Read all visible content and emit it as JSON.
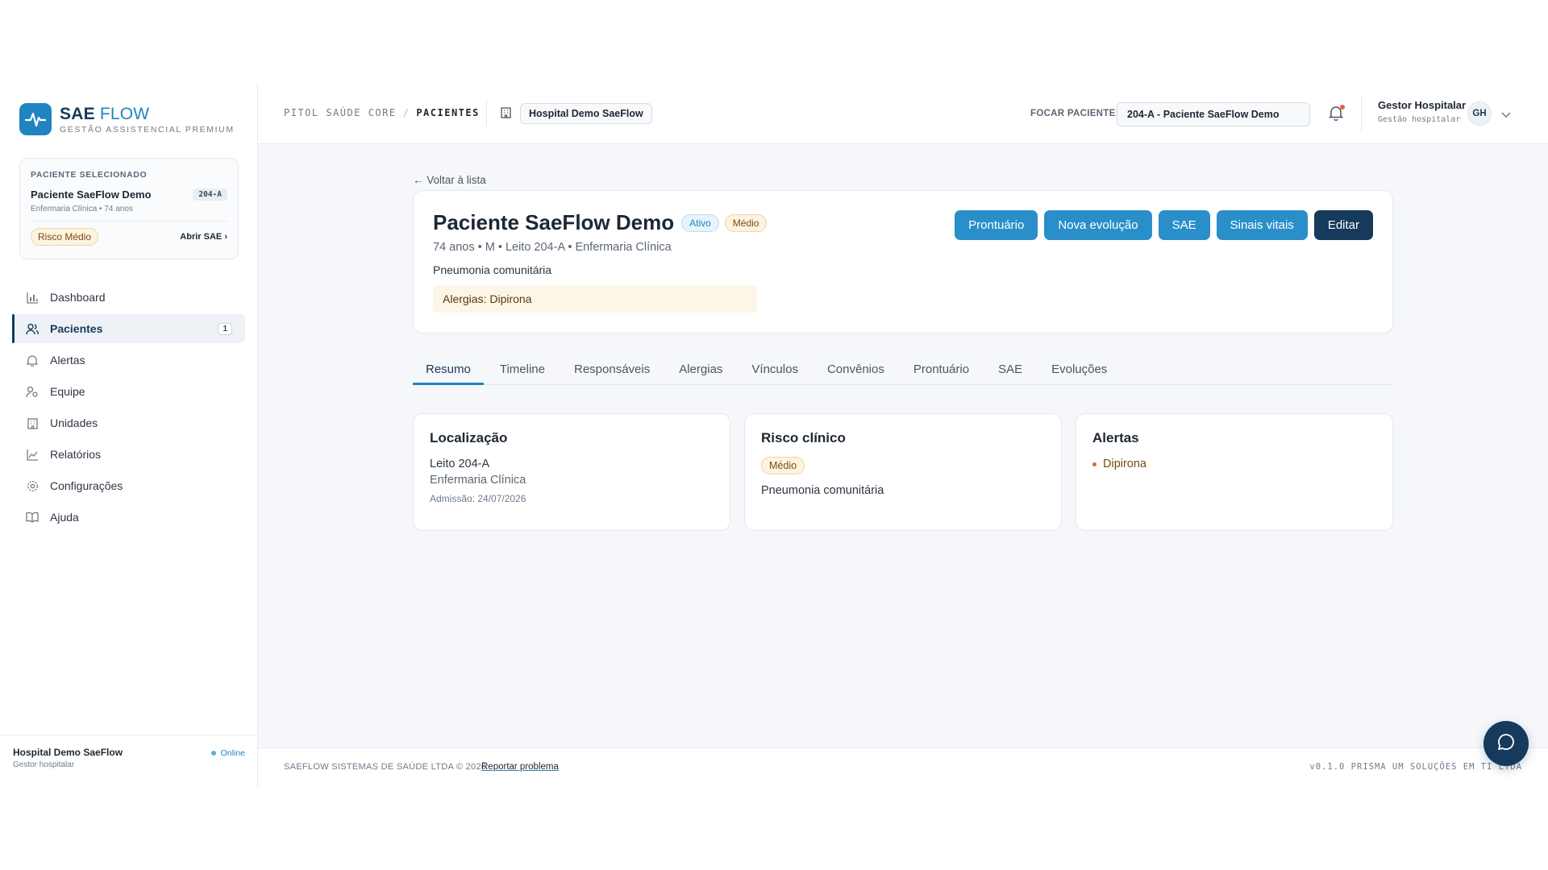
{
  "brand": {
    "name_part1": "SAE",
    "name_part2": "FLOW",
    "subtitle": "GESTÃO ASSISTENCIAL PREMIUM"
  },
  "selected_patient": {
    "label": "PACIENTE SELECIONADO",
    "name": "Paciente SaeFlow Demo",
    "bed": "204-A",
    "meta": "Enfermaria Clínica • 74 anos",
    "risk": "Risco Médio",
    "open_sae": "Abrir SAE"
  },
  "nav": {
    "items": [
      {
        "label": "Dashboard",
        "icon": "chart-icon"
      },
      {
        "label": "Pacientes",
        "icon": "users-icon",
        "badge": "1",
        "active": true
      },
      {
        "label": "Alertas",
        "icon": "bell-icon"
      },
      {
        "label": "Equipe",
        "icon": "team-icon"
      },
      {
        "label": "Unidades",
        "icon": "building-icon"
      },
      {
        "label": "Relatórios",
        "icon": "trend-icon"
      },
      {
        "label": "Configurações",
        "icon": "gear-icon"
      },
      {
        "label": "Ajuda",
        "icon": "book-icon"
      }
    ]
  },
  "sidebar_footer": {
    "hospital": "Hospital Demo SaeFlow",
    "role": "Gestor hospitalar",
    "status": "Online"
  },
  "topbar": {
    "crumb_root": "PITOL SAÚDE CORE",
    "crumb_sep": "/",
    "crumb_current": "PACIENTES",
    "hospital_chip": "Hospital Demo SaeFlow",
    "focus_label": "FOCAR PACIENTE:",
    "focus_value": "204-A - Paciente SaeFlow Demo",
    "user_name": "Gestor Hospitalar",
    "user_role": "Gestão hospitalar",
    "user_initials": "GH"
  },
  "back_link": "← Voltar à lista",
  "patient": {
    "name": "Paciente SaeFlow Demo",
    "status": "Ativo",
    "risk": "Médio",
    "meta": "74 anos • M • Leito 204-A • Enfermaria Clínica",
    "diagnosis": "Pneumonia comunitária",
    "allergies": "Alergias: Dipirona"
  },
  "actions": [
    "Prontuário",
    "Nova evolução",
    "SAE",
    "Sinais vitais",
    "Editar"
  ],
  "tabs": [
    "Resumo",
    "Timeline",
    "Responsáveis",
    "Alergias",
    "Vínculos",
    "Convênios",
    "Prontuário",
    "SAE",
    "Evoluções"
  ],
  "cards": {
    "location": {
      "title": "Localização",
      "bed": "Leito 204-A",
      "unit": "Enfermaria Clínica",
      "admission": "Admissão: 24/07/2026"
    },
    "risk": {
      "title": "Risco clínico",
      "level": "Médio",
      "diagnosis": "Pneumonia comunitária"
    },
    "alerts": {
      "title": "Alertas",
      "items": [
        "Dipirona"
      ]
    }
  },
  "footer": {
    "copyright": "SAEFLOW SISTEMAS DE SAÚDE LTDA © 2026",
    "report": "Reportar problema",
    "version": "v0.1.0   PRISMA UM SOLUÇÕES EM TI LTDA"
  }
}
